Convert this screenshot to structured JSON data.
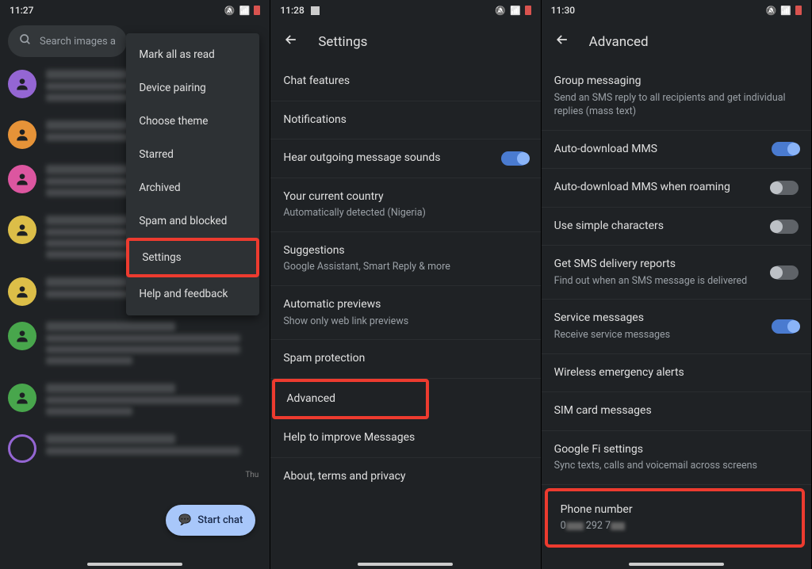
{
  "phone1": {
    "time": "11:27",
    "search_placeholder": "Search images an",
    "menu": {
      "mark_read": "Mark all as read",
      "device_pairing": "Device pairing",
      "choose_theme": "Choose theme",
      "starred": "Starred",
      "archived": "Archived",
      "spam_blocked": "Spam and blocked",
      "settings": "Settings",
      "help": "Help and feedback"
    },
    "fab": "Start chat",
    "timestamp_thu": "Thu"
  },
  "phone2": {
    "time": "11:28",
    "header": "Settings",
    "items": {
      "chat_features": "Chat features",
      "notifications": "Notifications",
      "hear_sounds": "Hear outgoing message sounds",
      "country_title": "Your current country",
      "country_sub": "Automatically detected (Nigeria)",
      "suggestions_title": "Suggestions",
      "suggestions_sub": "Google Assistant, Smart Reply & more",
      "previews_title": "Automatic previews",
      "previews_sub": "Show only web link previews",
      "spam": "Spam protection",
      "advanced": "Advanced",
      "improve": "Help to improve Messages",
      "about": "About, terms and privacy"
    }
  },
  "phone3": {
    "time": "11:30",
    "header": "Advanced",
    "items": {
      "group_title": "Group messaging",
      "group_sub": "Send an SMS reply to all recipients and get individual replies (mass text)",
      "auto_mms": "Auto-download MMS",
      "auto_mms_roam": "Auto-download MMS when roaming",
      "simple_chars": "Use simple characters",
      "delivery_title": "Get SMS delivery reports",
      "delivery_sub": "Find out when an SMS message is delivered",
      "service_title": "Service messages",
      "service_sub": "Receive service messages",
      "wireless_alerts": "Wireless emergency alerts",
      "sim_messages": "SIM card messages",
      "fi_title": "Google Fi settings",
      "fi_sub": "Sync texts, calls and voicemail across screens",
      "phone_title": "Phone number",
      "phone_prefix": "0",
      "phone_mid": " 292 7"
    }
  }
}
